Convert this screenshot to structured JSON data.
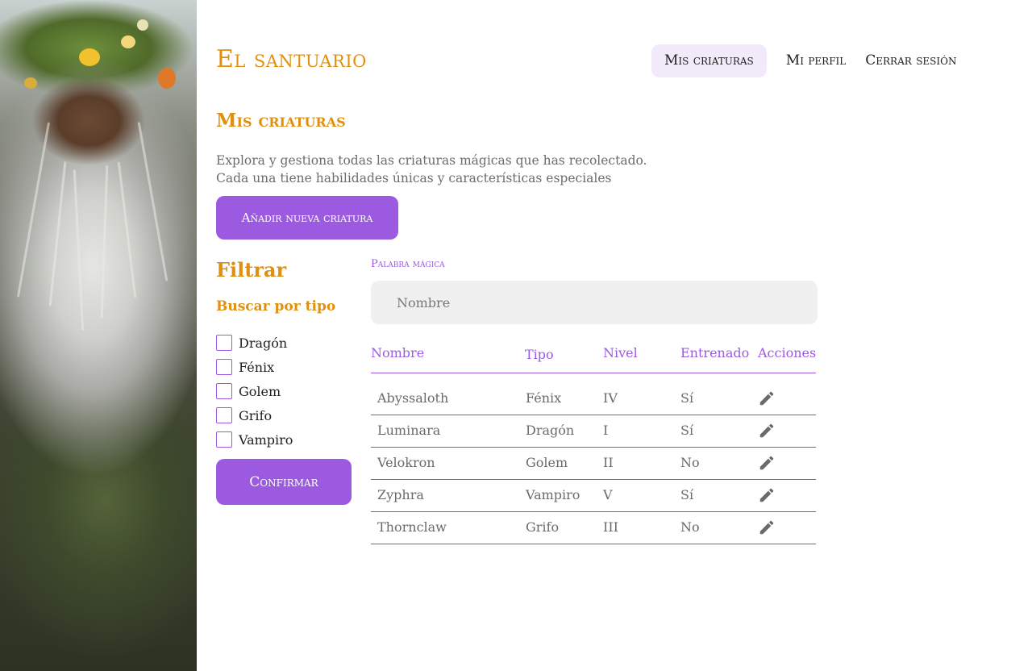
{
  "header": {
    "brand": "El santuario",
    "nav": [
      {
        "label": "Mis criaturas",
        "active": true
      },
      {
        "label": "Mi perfil",
        "active": false
      },
      {
        "label": "Cerrar sesión",
        "active": false
      }
    ]
  },
  "main": {
    "title": "Mis criaturas",
    "intro": "Explora y gestiona todas las criaturas mágicas que has recolectado. Cada una tiene habilidades únicas y características especiales",
    "add_button": "Añadir nueva criatura"
  },
  "filter": {
    "title": "Filtrar",
    "subtitle": "Buscar por tipo",
    "types": [
      "Dragón",
      "Fénix",
      "Golem",
      "Grifo",
      "Vampiro"
    ],
    "confirm_button": "Confirmar"
  },
  "search": {
    "label": "Palabra mágica",
    "placeholder": "Nombre",
    "value": ""
  },
  "table": {
    "columns": [
      "Nombre",
      "Tipo",
      "Nivel",
      "Entrenado",
      "Acciones"
    ],
    "rows": [
      [
        "Abyssaloth",
        "Fénix",
        "IV",
        "Sí"
      ],
      [
        "Luminara",
        "Dragón",
        "I",
        "Sí"
      ],
      [
        "Velokron",
        "Golem",
        "II",
        "No"
      ],
      [
        "Zyphra",
        "Vampiro",
        "V",
        "Sí"
      ],
      [
        "Thornclaw",
        "Grifo",
        "III",
        "No"
      ]
    ],
    "action_icon": "pencil-icon"
  },
  "colors": {
    "accent_orange": "#e0900f",
    "accent_purple": "#9b5ae0",
    "nav_active_bg": "#f1eaf8"
  },
  "side_image": "portrait of a bearded forest druid with a flower crown"
}
